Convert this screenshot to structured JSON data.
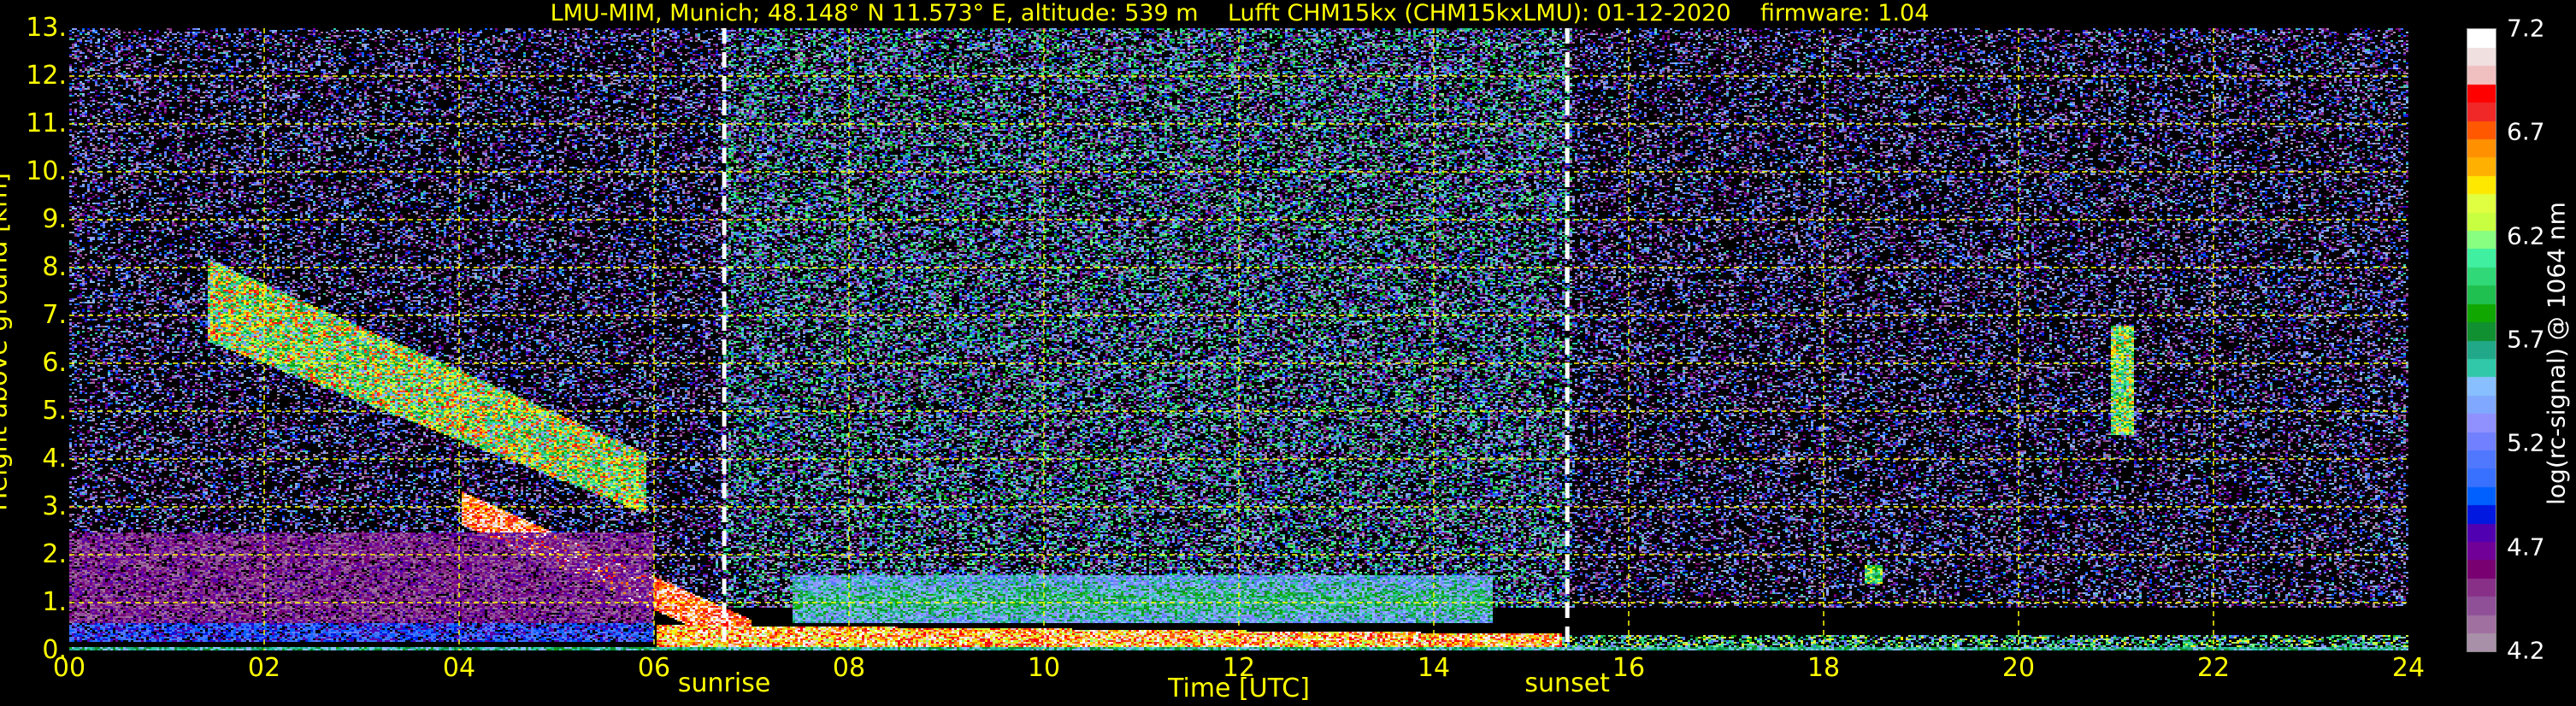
{
  "chart_data": {
    "type": "heatmap",
    "title": "LMU-MIM, Munich; 48.148° N 11.573° E, altitude: 539 m    Lufft CHM15kx (CHM15kxLMU): 01-12-2020    firmware: 1.04",
    "xlabel": "Time [UTC]",
    "ylabel": "Height above ground [km]",
    "xlim": [
      0,
      24
    ],
    "ylim": [
      0,
      13
    ],
    "xticks": [
      "00",
      "02",
      "04",
      "06",
      "08",
      "10",
      "12",
      "14",
      "16",
      "18",
      "20",
      "22",
      "24"
    ],
    "yticks": [
      "0.",
      "1.",
      "2.",
      "3.",
      "4.",
      "5.",
      "6.",
      "7.",
      "8.",
      "9.",
      "10.",
      "11.",
      "12.",
      "13."
    ],
    "grid": true,
    "grid_color": "#ffff00",
    "annotations": [
      {
        "text": "sunrise",
        "x": 6.72
      },
      {
        "text": "sunset",
        "x": 15.37
      }
    ],
    "colorbar": {
      "label": "log(rc-signal) @ 1064 nm",
      "range": [
        4.2,
        7.2
      ],
      "ticks": [
        "4.2",
        "4.7",
        "5.2",
        "5.7",
        "6.2",
        "6.7",
        "7.2"
      ],
      "colors": [
        "#a890a8",
        "#a070a0",
        "#905098",
        "#883088",
        "#780070",
        "#700098",
        "#5000b0",
        "#0018e0",
        "#0060ff",
        "#3870ff",
        "#5078ff",
        "#7080ff",
        "#9090ff",
        "#80a8ff",
        "#88c0ff",
        "#30c8a8",
        "#20a888",
        "#109030",
        "#10a800",
        "#20c050",
        "#30d878",
        "#40f0a0",
        "#88ff80",
        "#c8ff40",
        "#e0ff40",
        "#ffe800",
        "#ffb000",
        "#ff9000",
        "#ff5800",
        "#f02828",
        "#ff0000",
        "#f0c0c0",
        "#f0e0e0",
        "#ffffff"
      ]
    }
  }
}
